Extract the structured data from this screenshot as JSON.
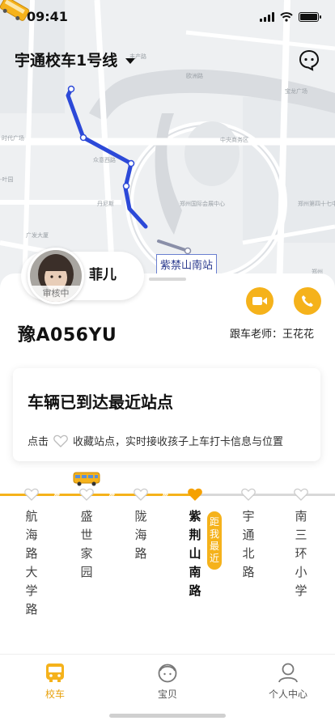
{
  "status_bar": {
    "time": "09:41"
  },
  "header": {
    "route_name": "宇通校车1号线"
  },
  "map": {
    "current_stop_label": "紫禁山南站",
    "labels": [
      "丰产路",
      "欧洲路",
      "时代广场",
      "宝龙广场",
      "中央商务区",
      "-叶园",
      "众意西路",
      "郑州国际会展中心",
      "丹尼斯",
      "郑州第四十七中学东校区",
      "广发大厦",
      "郑州"
    ]
  },
  "child": {
    "name": "菲儿",
    "status_badge": "审核中"
  },
  "vehicle": {
    "plate": "豫A056YU",
    "teacher_label": "跟车老师：王花花"
  },
  "notice": {
    "title": "车辆已到达最近站点",
    "tip_prefix": "点击",
    "tip_suffix": "收藏站点，实时接收孩子上车打卡信息与位置"
  },
  "stops": [
    {
      "name": "航海路大学路",
      "state": "passed"
    },
    {
      "name": "盛世家园",
      "state": "passed"
    },
    {
      "name": "陇海路",
      "state": "upcoming"
    },
    {
      "name": "紫荆山南路",
      "state": "current"
    },
    {
      "name": "宇通北路",
      "state": "upcoming"
    },
    {
      "name": "南三环小学",
      "state": "upcoming"
    }
  ],
  "nearest_tag": "距我最近",
  "tabs": [
    {
      "label": "校车",
      "icon": "school-bus-icon",
      "active": true
    },
    {
      "label": "宝贝",
      "icon": "child-face-icon",
      "active": false
    },
    {
      "label": "个人中心",
      "icon": "person-icon",
      "active": false
    }
  ],
  "colors": {
    "accent": "#f5b21b",
    "route": "#2c49d8"
  }
}
